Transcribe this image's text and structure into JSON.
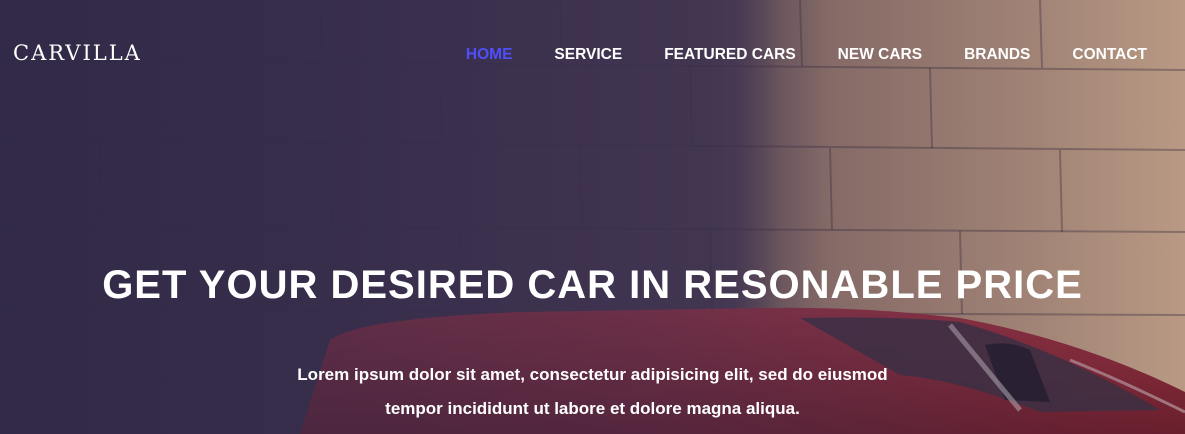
{
  "brand": {
    "logo": "CARVILLA"
  },
  "nav": {
    "items": [
      {
        "label": "HOME",
        "active": true
      },
      {
        "label": "SERVICE",
        "active": false
      },
      {
        "label": "FEATURED CARS",
        "active": false
      },
      {
        "label": "NEW CARS",
        "active": false
      },
      {
        "label": "BRANDS",
        "active": false
      },
      {
        "label": "CONTACT",
        "active": false
      }
    ],
    "active_color": "#4e4ffa"
  },
  "hero": {
    "title": "GET YOUR DESIRED CAR IN RESONABLE PRICE",
    "text_line1": "Lorem ipsum dolor sit amet, consectetur adipisicing elit, sed do eiusmod",
    "text_line2": "tempor incididunt ut labore et dolore magna aliqua."
  }
}
